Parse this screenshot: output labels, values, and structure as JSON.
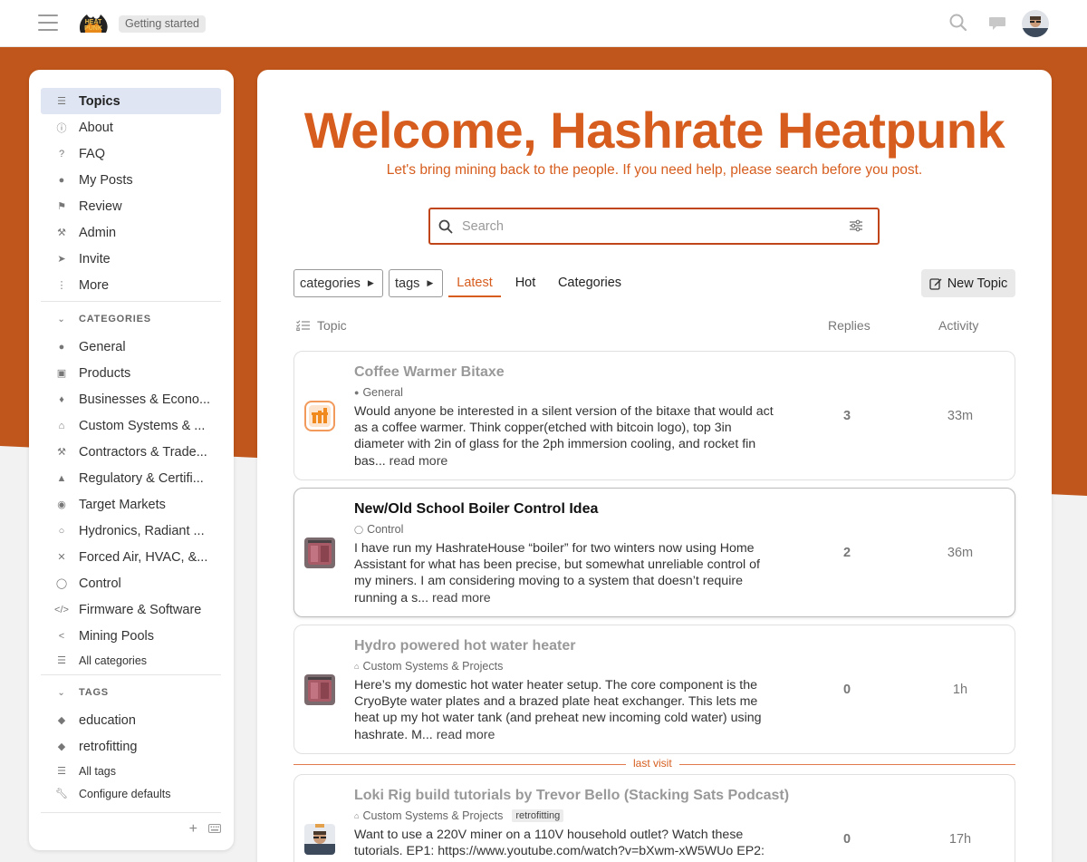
{
  "header": {
    "logo_text": "HEAT PUNK",
    "breadcrumb": "Getting started",
    "icons": [
      "hamburger-icon",
      "search-icon",
      "chat-icon",
      "user-avatar"
    ]
  },
  "sidebar": {
    "items": [
      {
        "label": "Topics",
        "icon": "topics-icon",
        "active": true
      },
      {
        "label": "About",
        "icon": "info-icon"
      },
      {
        "label": "FAQ",
        "icon": "question-icon"
      },
      {
        "label": "My Posts",
        "icon": "user-icon"
      },
      {
        "label": "Review",
        "icon": "flag-icon"
      },
      {
        "label": "Admin",
        "icon": "wrench-icon"
      },
      {
        "label": "Invite",
        "icon": "paper-plane-icon"
      },
      {
        "label": "More",
        "icon": "ellipsis-icon"
      }
    ],
    "categories_heading": "CATEGORIES",
    "categories": [
      {
        "label": "General",
        "icon": "comment-icon"
      },
      {
        "label": "Products",
        "icon": "gift-icon"
      },
      {
        "label": "Businesses & Econo...",
        "icon": "handshake-icon"
      },
      {
        "label": "Custom Systems & ...",
        "icon": "home-icon"
      },
      {
        "label": "Contractors & Trade...",
        "icon": "wrench-icon"
      },
      {
        "label": "Regulatory & Certifi...",
        "icon": "stamp-icon"
      },
      {
        "label": "Target Markets",
        "icon": "globe-icon"
      },
      {
        "label": "Hydronics, Radiant ...",
        "icon": "circle-icon"
      },
      {
        "label": "Forced Air, HVAC, &...",
        "icon": "close-icon"
      },
      {
        "label": "Control",
        "icon": "toggle-icon"
      },
      {
        "label": "Firmware & Software",
        "icon": "code-icon"
      },
      {
        "label": "Mining Pools",
        "icon": "share-icon"
      }
    ],
    "all_categories": "All categories",
    "tags_heading": "TAGS",
    "tags": [
      {
        "label": "education",
        "icon": "tag-icon"
      },
      {
        "label": "retrofitting",
        "icon": "tag-icon"
      }
    ],
    "all_tags": "All tags",
    "configure_defaults": "Configure defaults"
  },
  "main": {
    "welcome": "Welcome, Hashrate Heatpunk",
    "subtitle": "Let's bring mining back to the people. If you need help, please search before you post.",
    "search_placeholder": "Search",
    "filters": {
      "categories": "categories",
      "tags": "tags",
      "tabs": [
        "Latest",
        "Hot",
        "Categories"
      ],
      "active_tab": "Latest",
      "new_topic": "New Topic"
    },
    "columns": {
      "topic": "Topic",
      "replies": "Replies",
      "activity": "Activity"
    },
    "topics": [
      {
        "title": "Coffee Warmer Bitaxe",
        "category": "General",
        "category_icon": "comment-icon",
        "excerpt": "Would anyone be interested in a silent version of the bitaxe that would act as a coffee warmer. Think copper(etched with bitcoin logo), top 3in diameter with 2in of glass for the 2ph immersion cooling, and rocket fin bas...",
        "read_more": "read more",
        "replies": "3",
        "activity": "33m",
        "read": true
      },
      {
        "title": "New/Old School Boiler Control Idea",
        "category": "Control",
        "category_icon": "toggle-icon",
        "excerpt": "I have run my HashrateHouse “boiler” for two winters now using Home Assistant for what has been precise, but somewhat unreliable control of my miners. I am considering moving to a system that doesn’t require running a s...",
        "read_more": "read more",
        "replies": "2",
        "activity": "36m",
        "read": false
      },
      {
        "title": "Hydro powered hot water heater",
        "category": "Custom Systems & Projects",
        "category_icon": "home-icon",
        "excerpt": "Here’s my domestic hot water heater setup. The core component is the CryoByte water plates and a brazed plate heat exchanger. This lets me heat up my hot water tank (and preheat new incoming cold water) using hashrate. M...",
        "read_more": "read more",
        "replies": "0",
        "activity": "1h",
        "read": true
      },
      {
        "title": "Loki Rig build tutorials by Trevor Bello (Stacking Sats Podcast)",
        "category": "Custom Systems & Projects",
        "category_icon": "home-icon",
        "tag": "retrofitting",
        "excerpt": "Want to use a 220V miner on a 110V household outlet? Watch these tutorials. EP1: https://www.youtube.com/watch?v=bXwm-xW5WUo EP2:",
        "read_more": "",
        "replies": "0",
        "activity": "17h",
        "read": true
      }
    ],
    "last_visit": "last visit"
  },
  "colors": {
    "accent": "#d65d1e",
    "band": "#c0561b",
    "active_nav_bg": "#dfe5f3"
  }
}
